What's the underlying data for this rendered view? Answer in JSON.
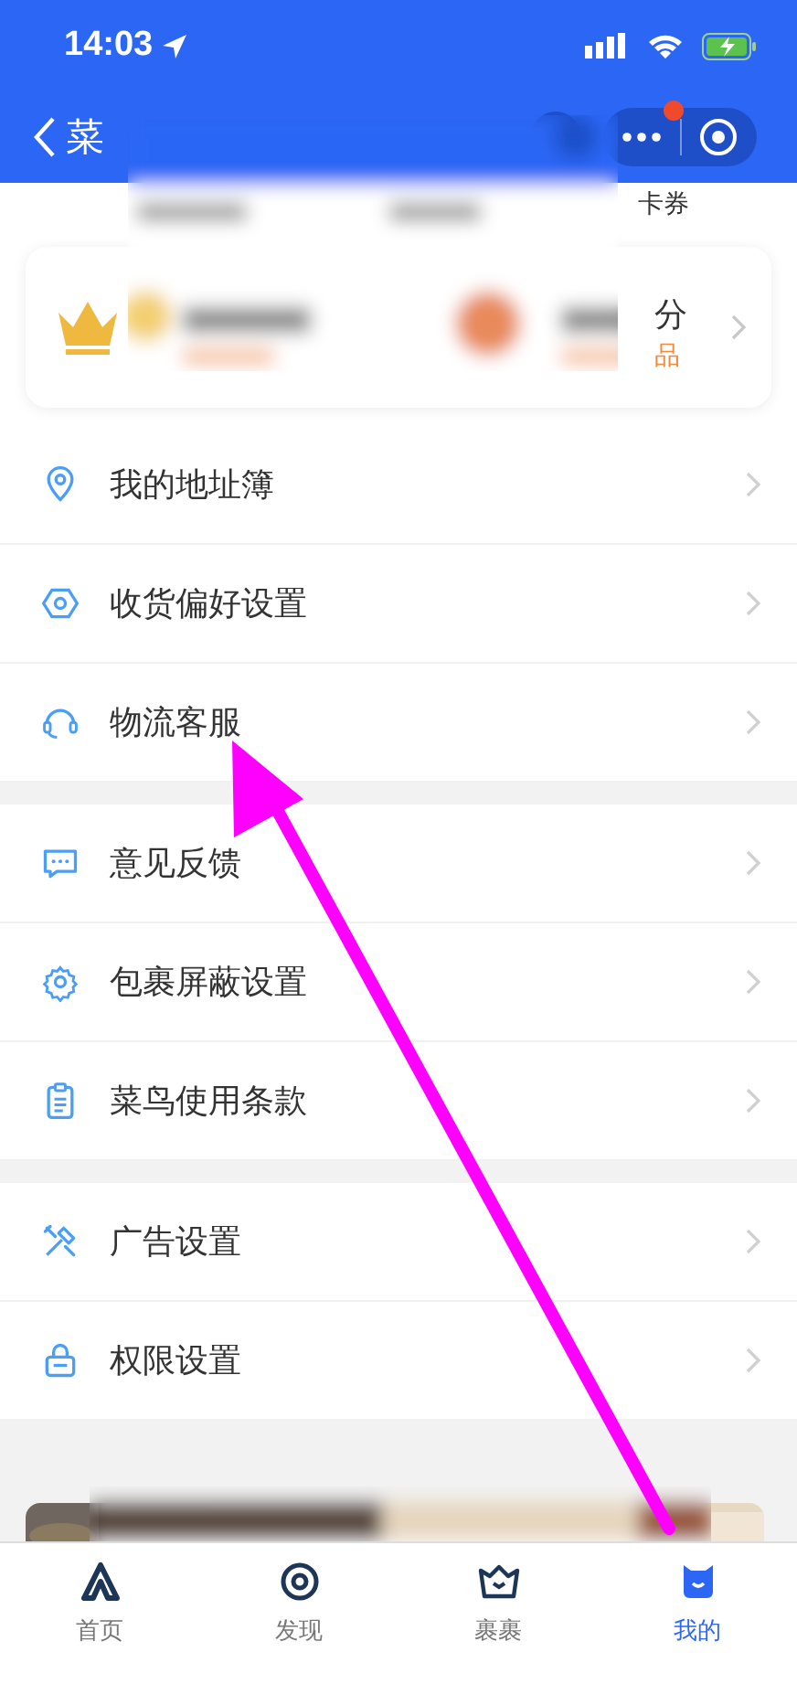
{
  "status_bar": {
    "time": "14:03"
  },
  "nav": {
    "title": "菜"
  },
  "top_row": {
    "label": "卡券"
  },
  "card": {
    "right_title": "分",
    "right_subtitle": "品"
  },
  "menu_sections": [
    [
      {
        "kind": "pin",
        "label": "我的地址簿"
      },
      {
        "kind": "hexagon",
        "label": "收货偏好设置"
      },
      {
        "kind": "headset",
        "label": "物流客服"
      }
    ],
    [
      {
        "kind": "chat",
        "label": "意见反馈"
      },
      {
        "kind": "gear",
        "label": "包裹屏蔽设置"
      },
      {
        "kind": "clipboard",
        "label": "菜鸟使用条款"
      }
    ],
    [
      {
        "kind": "tools",
        "label": "广告设置"
      },
      {
        "kind": "lock",
        "label": "权限设置"
      }
    ]
  ],
  "banners": [
    {
      "kind": "picture"
    },
    {
      "kind": "picture"
    }
  ],
  "tab_bar": [
    {
      "kind": "home",
      "label": "首页",
      "selected": false
    },
    {
      "kind": "discover",
      "label": "发现",
      "selected": false
    },
    {
      "kind": "basket",
      "label": "裹裹",
      "selected": false
    },
    {
      "kind": "me",
      "label": "我的",
      "selected": true
    }
  ]
}
